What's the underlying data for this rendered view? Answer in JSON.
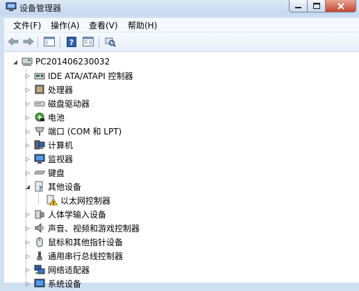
{
  "window": {
    "title": "设备管理器"
  },
  "menu": {
    "file": "文件(F)",
    "action": "操作(A)",
    "view": "查看(V)",
    "help": "帮助(H)"
  },
  "tree": {
    "root": "PC201406230032",
    "items": [
      {
        "label": "IDE ATA/ATAPI 控制器",
        "icon": "ide-controller-icon"
      },
      {
        "label": "处理器",
        "icon": "processor-icon"
      },
      {
        "label": "磁盘驱动器",
        "icon": "disk-drive-icon"
      },
      {
        "label": "电池",
        "icon": "battery-icon"
      },
      {
        "label": "端口 (COM 和 LPT)",
        "icon": "port-icon"
      },
      {
        "label": "计算机",
        "icon": "computer-icon"
      },
      {
        "label": "监视器",
        "icon": "monitor-icon"
      },
      {
        "label": "键盘",
        "icon": "keyboard-icon"
      },
      {
        "label": "其他设备",
        "icon": "other-devices-icon",
        "expanded": true,
        "children": [
          {
            "label": "以太网控制器",
            "icon": "warning-device-icon"
          }
        ]
      },
      {
        "label": "人体学输入设备",
        "icon": "hid-icon"
      },
      {
        "label": "声音、视频和游戏控制器",
        "icon": "sound-icon"
      },
      {
        "label": "鼠标和其他指针设备",
        "icon": "mouse-icon"
      },
      {
        "label": "通用串行总线控制器",
        "icon": "usb-icon"
      },
      {
        "label": "网络适配器",
        "icon": "network-adapter-icon"
      },
      {
        "label": "系统设备",
        "icon": "system-devices-icon"
      }
    ]
  }
}
